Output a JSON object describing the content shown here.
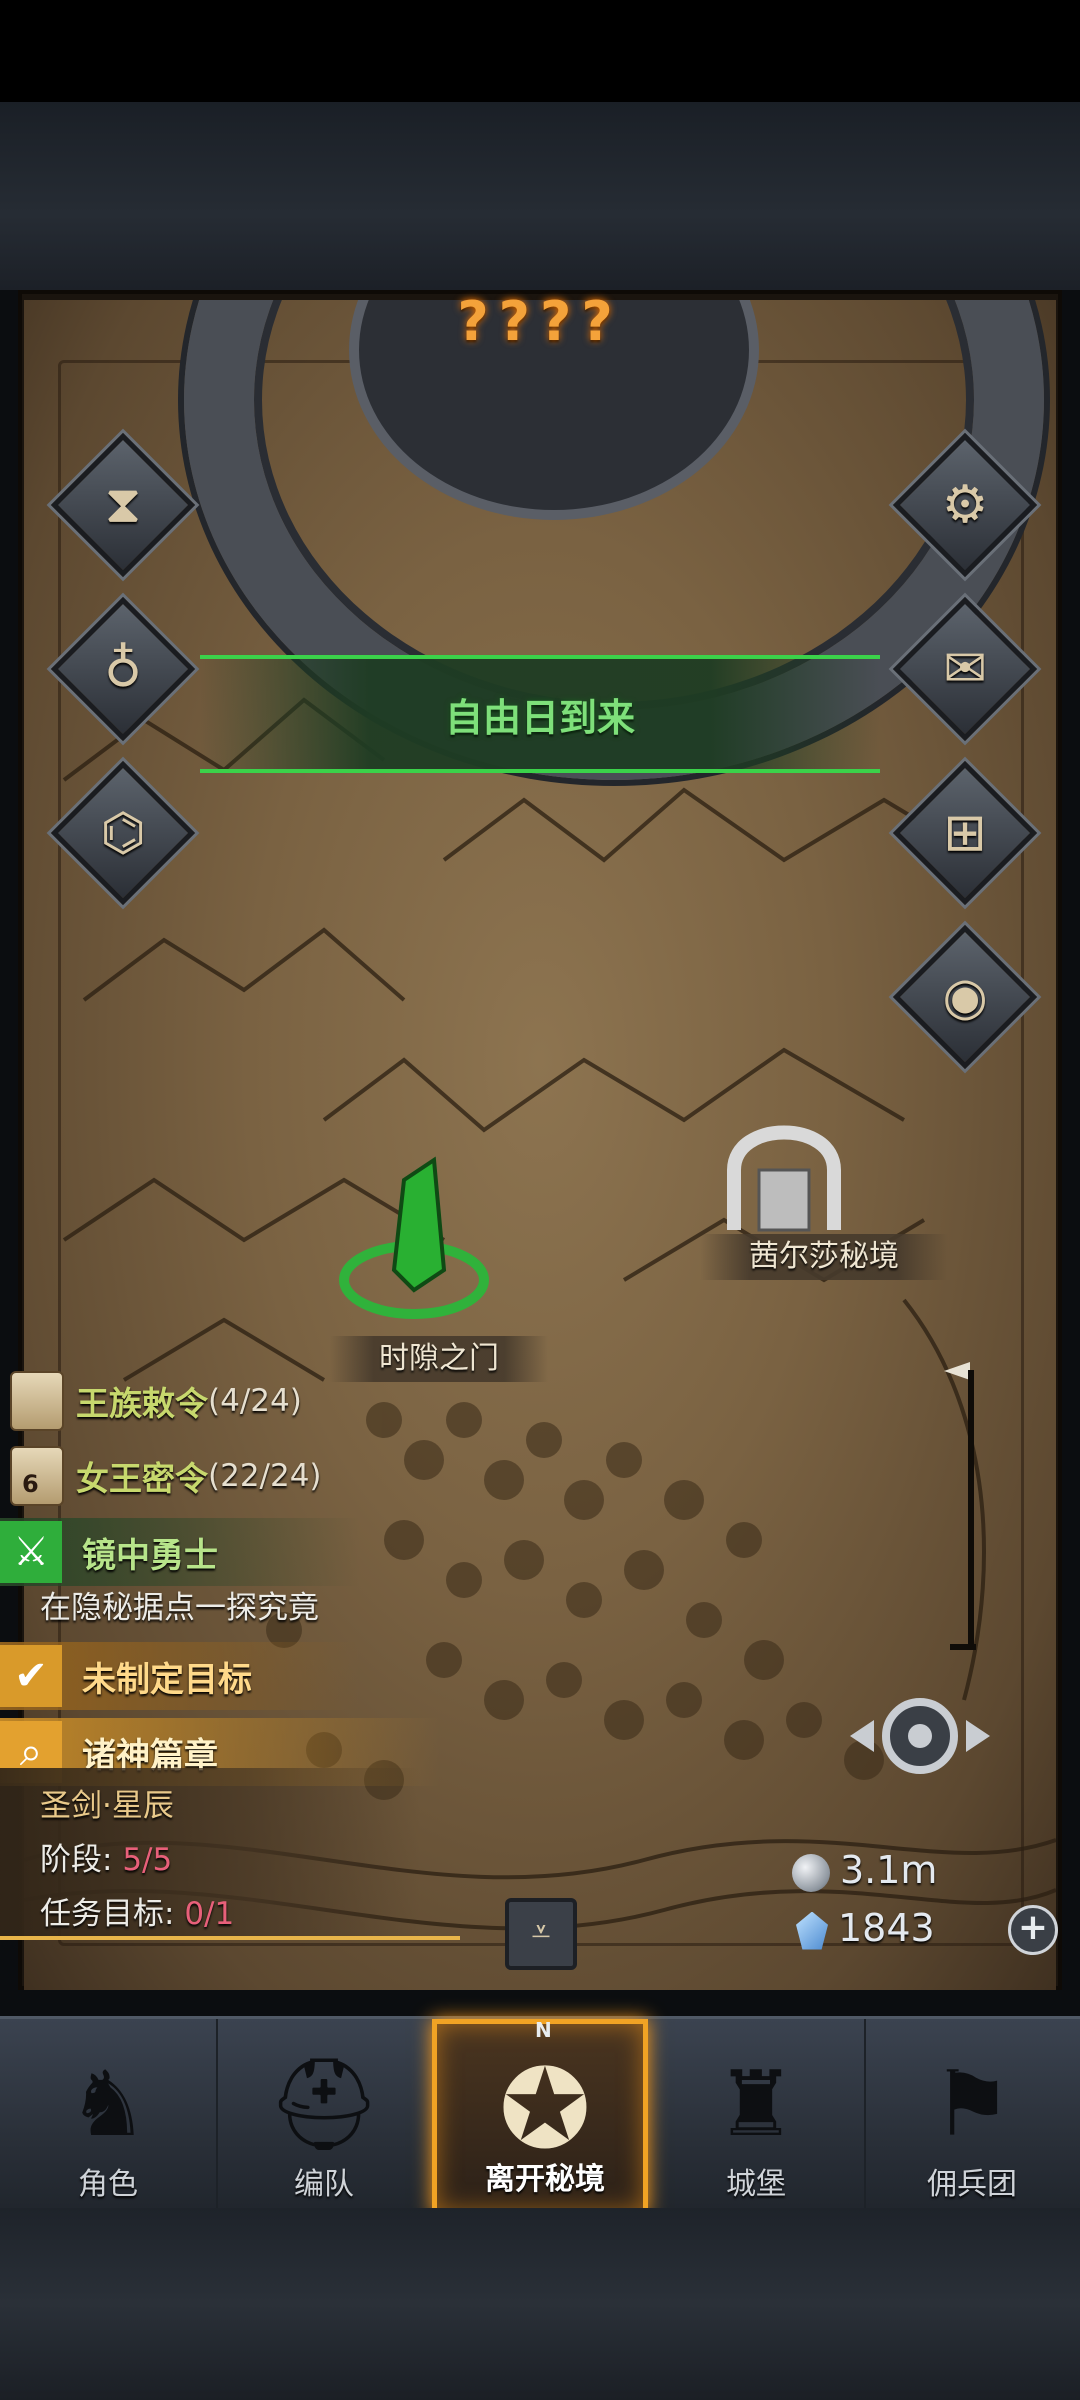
{
  "header": {
    "title": "????"
  },
  "banner": {
    "text": "自由日到来"
  },
  "side_buttons": {
    "left": [
      {
        "icon": "hourglass-icon"
      },
      {
        "icon": "bag-icon"
      },
      {
        "icon": "scroll-map-icon"
      }
    ],
    "right": [
      {
        "icon": "gear-icon"
      },
      {
        "icon": "mail-icon"
      },
      {
        "icon": "shop-stall-icon"
      },
      {
        "icon": "coin-icon"
      }
    ]
  },
  "locations": [
    {
      "name": "茜尔莎秘境"
    },
    {
      "name": "时隙之门"
    }
  ],
  "quests": [
    {
      "title": "王族敕令",
      "count": "(4/24)",
      "icon_num": ""
    },
    {
      "title": "女王密令",
      "count": "(22/24)",
      "icon_num": "6"
    }
  ],
  "tasks": {
    "mirror": {
      "title": "镜中勇士",
      "desc": "在隐秘据点一探究竟"
    },
    "goal": {
      "title": "未制定目标"
    },
    "saga": {
      "title": "诸神篇章",
      "name": "圣剑·星辰",
      "stage_label": "阶段:",
      "stage_value": "5/5",
      "target_label": "任务目标:",
      "target_value": "0/1"
    }
  },
  "currency": {
    "silver": "3.1m",
    "gems": "1843",
    "plus": "+"
  },
  "nav": {
    "compass_mark": "N",
    "items": [
      {
        "label": "角色",
        "icon": "knight-icon"
      },
      {
        "label": "编队",
        "icon": "helmet-icon"
      },
      {
        "label": "离开秘境",
        "icon": "compass-icon",
        "active": true
      },
      {
        "label": "城堡",
        "icon": "castle-icon"
      },
      {
        "label": "佣兵团",
        "icon": "banner-icon"
      }
    ]
  },
  "colors": {
    "accent_orange": "#f1a324",
    "banner_green": "#3bd24a",
    "quest_text": "#c7d86d",
    "task_value": "#e8607a"
  }
}
